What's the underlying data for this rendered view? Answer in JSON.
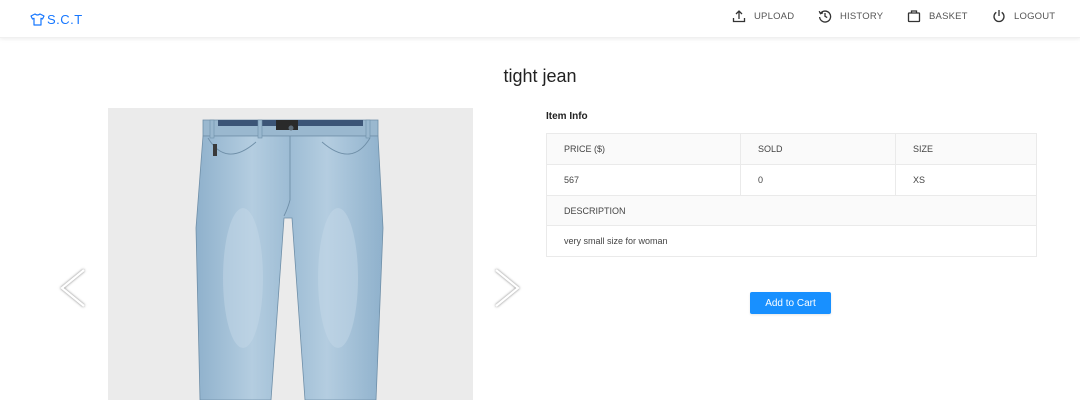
{
  "header": {
    "logo_text": "S.C.T",
    "nav": [
      {
        "label": "UPLOAD",
        "icon": "upload-icon"
      },
      {
        "label": "HISTORY",
        "icon": "history-icon"
      },
      {
        "label": "BASKET",
        "icon": "basket-icon"
      },
      {
        "label": "LOGOUT",
        "icon": "power-icon"
      }
    ]
  },
  "product": {
    "title": "tight jean",
    "image_description": "light blue jeans",
    "info_label": "Item Info",
    "table": {
      "headers": {
        "price": "PRICE ($)",
        "sold": "SOLD",
        "size": "SIZE",
        "description": "DESCRIPTION"
      },
      "values": {
        "price": "567",
        "sold": "0",
        "size": "XS",
        "description": "very small size for woman"
      }
    },
    "add_to_cart_label": "Add to Cart"
  },
  "colors": {
    "accent": "#1890ff",
    "jeans": "#a9c4d9"
  }
}
